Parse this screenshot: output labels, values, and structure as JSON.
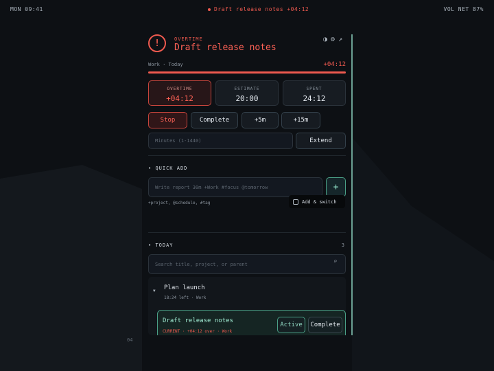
{
  "topbar": {
    "clock": "MON 09:41",
    "current_task": "Draft release notes +04:12",
    "vol_net": "VOL NET 87%"
  },
  "panel_index": "04",
  "header": {
    "kicker": "OVERTIME",
    "title": "Draft release notes",
    "meta": "Work · Today",
    "elapsed": "+04:12",
    "icons": [
      "contrast-icon",
      "gear-icon",
      "external-link-icon"
    ],
    "progress": 1.0
  },
  "stats": [
    {
      "label": "OVERTIME",
      "value": "+04:12"
    },
    {
      "label": "ESTIMATE",
      "value": "20:00"
    },
    {
      "label": "SPENT",
      "value": "24:12"
    }
  ],
  "actions": {
    "stop": "Stop",
    "complete": "Complete",
    "plus5": "+5m",
    "plus15": "+15m"
  },
  "extend": {
    "placeholder": "Minutes (1-1440)",
    "button": "Extend"
  },
  "quick_add": {
    "heading": "QUICK ADD",
    "placeholder": "Write report 30m +Work #focus @tomorrow",
    "add_label": "+",
    "hint": "+project, @schedule, #tag",
    "tooltip": "Add & switch"
  },
  "today": {
    "heading": "TODAY",
    "count": "3",
    "search_placeholder": "Search title, project, or parent",
    "group": {
      "name": "Plan launch",
      "meta": "18:24 left · Work"
    },
    "task": {
      "name": "Draft release notes",
      "meta": "CURRENT · +04:12 over · Work",
      "active_label": "Active",
      "complete_label": "Complete"
    }
  },
  "colors": {
    "accent_red": "#ef5a4f",
    "accent_teal": "#8fd6c0",
    "background": "#0d1014"
  }
}
